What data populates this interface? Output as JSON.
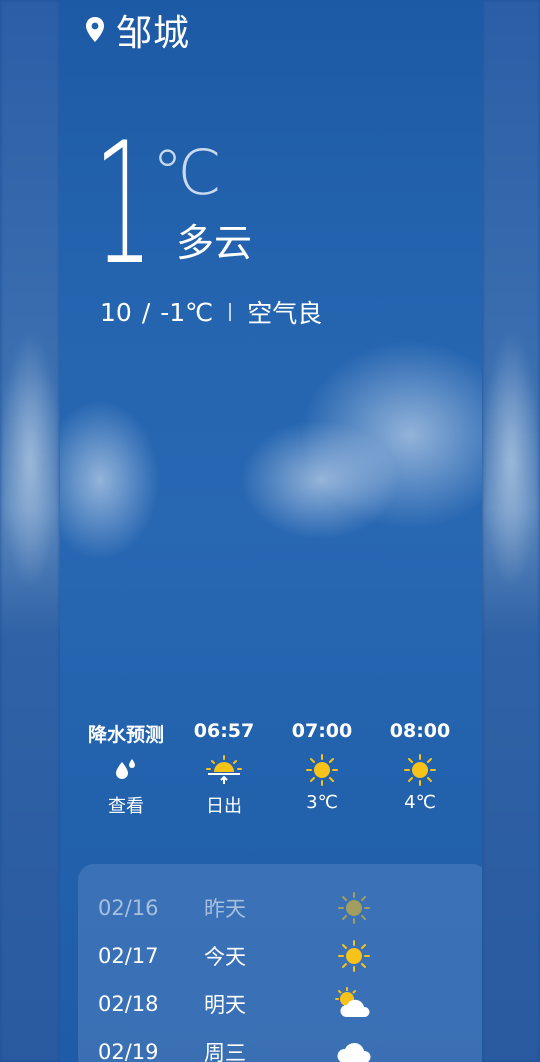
{
  "location": {
    "city": "邹城",
    "icon": "location-pin-icon"
  },
  "current": {
    "temperature": "1",
    "unit": "℃",
    "condition": "多云",
    "high": "10",
    "divider": "/",
    "low": "-1℃",
    "air_quality": "空气良"
  },
  "hourly": [
    {
      "time": "降水预测",
      "icon": "rain-drops-icon",
      "value": "查看"
    },
    {
      "time": "06:57",
      "icon": "sunrise-icon",
      "value": "日出"
    },
    {
      "time": "07:00",
      "icon": "sun-icon",
      "value": "3℃"
    },
    {
      "time": "08:00",
      "icon": "sun-icon",
      "value": "4℃"
    }
  ],
  "daily": [
    {
      "date": "02/16",
      "day": "昨天",
      "icon": "sun-icon"
    },
    {
      "date": "02/17",
      "day": "今天",
      "icon": "sun-icon"
    },
    {
      "date": "02/18",
      "day": "明天",
      "icon": "partly-cloudy-icon"
    },
    {
      "date": "02/19",
      "day": "周三",
      "icon": "cloud-icon"
    }
  ],
  "colors": {
    "sun": "#f7c21a",
    "background": "#2565b0",
    "panel": "#5c87c4"
  }
}
